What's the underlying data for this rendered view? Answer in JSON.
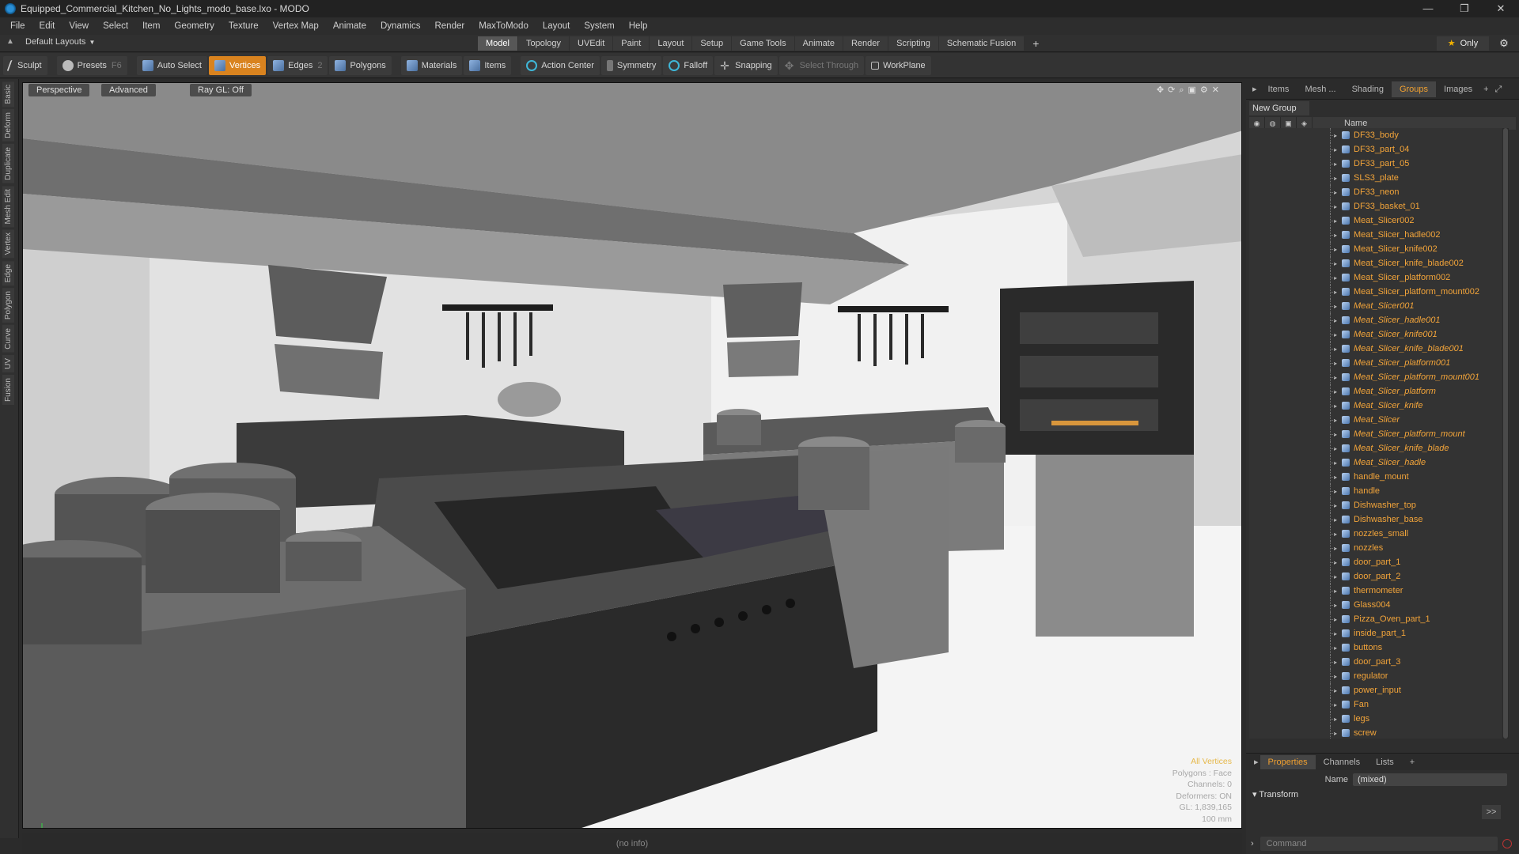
{
  "window": {
    "title": "Equipped_Commercial_Kitchen_No_Lights_modo_base.lxo - MODO",
    "controls": [
      "—",
      "❐",
      "✕"
    ]
  },
  "menu": [
    "File",
    "Edit",
    "View",
    "Select",
    "Item",
    "Geometry",
    "Texture",
    "Vertex Map",
    "Animate",
    "Dynamics",
    "Render",
    "MaxToModo",
    "Layout",
    "System",
    "Help"
  ],
  "layout": {
    "name": "Default Layouts",
    "tabs": [
      "Model",
      "Topology",
      "UVEdit",
      "Paint",
      "Layout",
      "Setup",
      "Game Tools",
      "Animate",
      "Render",
      "Scripting",
      "Schematic Fusion"
    ],
    "active_tab": "Model",
    "only_label": "Only"
  },
  "toolbar": {
    "sculpt": "Sculpt",
    "presets": "Presets",
    "presets_key": "F6",
    "auto_select": "Auto Select",
    "vertices": "Vertices",
    "edges": "Edges",
    "edges_key": "2",
    "polygons": "Polygons",
    "materials": "Materials",
    "items": "Items",
    "action_center": "Action Center",
    "symmetry": "Symmetry",
    "falloff": "Falloff",
    "snapping": "Snapping",
    "select_through": "Select Through",
    "workplane": "WorkPlane"
  },
  "left_tabs": [
    "Basic",
    "Deform",
    "Duplicate",
    "Mesh Edit",
    "Vertex",
    "Edge",
    "Polygon",
    "Curve",
    "UV",
    "Fusion"
  ],
  "viewport": {
    "view": "Perspective",
    "shading": "Advanced",
    "raygl": "Ray GL: Off",
    "stats": {
      "mode": "All Vertices",
      "polygons": "Polygons : Face",
      "channels": "Channels: 0",
      "deformers": "Deformers: ON",
      "gl": "GL: 1,839,165",
      "scale": "100 mm"
    }
  },
  "status": "(no info)",
  "right_panel": {
    "tabs": [
      "Items",
      "Mesh ...",
      "Shading",
      "Groups",
      "Images"
    ],
    "active_tab": "Groups",
    "new_group": "New Group",
    "name_header": "Name",
    "groups": [
      {
        "name": "DF33_body",
        "italic": false
      },
      {
        "name": "DF33_part_04",
        "italic": false
      },
      {
        "name": "DF33_part_05",
        "italic": false
      },
      {
        "name": "SLS3_plate",
        "italic": false
      },
      {
        "name": "DF33_neon",
        "italic": false
      },
      {
        "name": "DF33_basket_01",
        "italic": false
      },
      {
        "name": "Meat_Slicer002",
        "italic": false
      },
      {
        "name": "Meat_Slicer_hadle002",
        "italic": false
      },
      {
        "name": "Meat_Slicer_knife002",
        "italic": false
      },
      {
        "name": "Meat_Slicer_knife_blade002",
        "italic": false
      },
      {
        "name": "Meat_Slicer_platform002",
        "italic": false
      },
      {
        "name": "Meat_Slicer_platform_mount002",
        "italic": false
      },
      {
        "name": "Meat_Slicer001",
        "italic": true
      },
      {
        "name": "Meat_Slicer_hadle001",
        "italic": true
      },
      {
        "name": "Meat_Slicer_knife001",
        "italic": true
      },
      {
        "name": "Meat_Slicer_knife_blade001",
        "italic": true
      },
      {
        "name": "Meat_Slicer_platform001",
        "italic": true
      },
      {
        "name": "Meat_Slicer_platform_mount001",
        "italic": true
      },
      {
        "name": "Meat_Slicer_platform",
        "italic": true
      },
      {
        "name": "Meat_Slicer_knife",
        "italic": true
      },
      {
        "name": "Meat_Slicer",
        "italic": true
      },
      {
        "name": "Meat_Slicer_platform_mount",
        "italic": true
      },
      {
        "name": "Meat_Slicer_knife_blade",
        "italic": true
      },
      {
        "name": "Meat_Slicer_hadle",
        "italic": true
      },
      {
        "name": "handle_mount",
        "italic": false
      },
      {
        "name": "handle",
        "italic": false
      },
      {
        "name": "Dishwasher_top",
        "italic": false
      },
      {
        "name": "Dishwasher_base",
        "italic": false
      },
      {
        "name": "nozzles_small",
        "italic": false
      },
      {
        "name": "nozzles",
        "italic": false
      },
      {
        "name": "door_part_1",
        "italic": false
      },
      {
        "name": "door_part_2",
        "italic": false
      },
      {
        "name": "thermometer",
        "italic": false
      },
      {
        "name": "Glass004",
        "italic": false
      },
      {
        "name": "Pizza_Oven_part_1",
        "italic": false
      },
      {
        "name": "inside_part_1",
        "italic": false
      },
      {
        "name": "buttons",
        "italic": false
      },
      {
        "name": "door_part_3",
        "italic": false
      },
      {
        "name": "regulator",
        "italic": false
      },
      {
        "name": "power_input",
        "italic": false
      },
      {
        "name": "Fan",
        "italic": false
      },
      {
        "name": "legs",
        "italic": false
      },
      {
        "name": "screw",
        "italic": false
      }
    ],
    "properties": {
      "tabs": [
        "Properties",
        "Channels",
        "Lists"
      ],
      "active_tab": "Properties",
      "name_label": "Name",
      "name_value": "(mixed)",
      "transform": "Transform",
      "arrow": ">>"
    },
    "command_placeholder": "Command"
  },
  "colors": {
    "accent": "#d9831f",
    "group_text": "#f2a43a",
    "viewport_bg": "#d8d8d8"
  }
}
